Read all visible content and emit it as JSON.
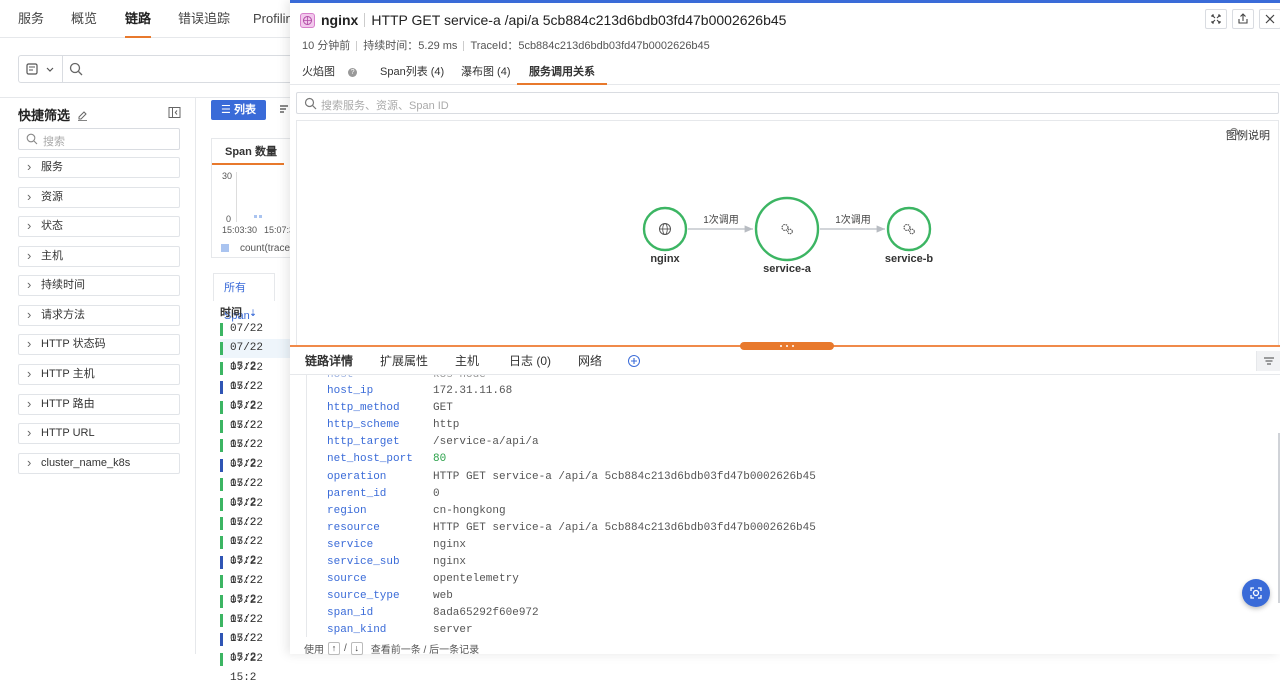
{
  "topnav": {
    "items": [
      "服务",
      "概览",
      "链路",
      "错误追踪",
      "Profilin"
    ],
    "active": 2
  },
  "sidebar": {
    "title": "快捷筛选",
    "search_placeholder": "搜索",
    "facets": [
      "服务",
      "资源",
      "状态",
      "主机",
      "持续时间",
      "请求方法",
      "HTTP 状态码",
      "HTTP 主机",
      "HTTP 路由",
      "HTTP URL",
      "cluster_name_k8s"
    ]
  },
  "list": {
    "list_button": "列表",
    "span_count_tab": "Span 数量",
    "y_max": "30",
    "y_min": "0",
    "x_ticks": [
      "15:03:30",
      "15:07:3"
    ],
    "legend": "count(trace",
    "all_span_tab": "所有 Span",
    "time_header": "时间",
    "rows": [
      {
        "time": "07/22  15:2",
        "color": "#3cb563"
      },
      {
        "time": "07/22  15:2",
        "color": "#3cb563"
      },
      {
        "time": "07/22  15:2",
        "color": "#3cb563"
      },
      {
        "time": "07/22  15:2",
        "color": "#2f55b4"
      },
      {
        "time": "07/22  15:2",
        "color": "#3cb563"
      },
      {
        "time": "07/22  15:2",
        "color": "#3cb563"
      },
      {
        "time": "07/22  15:2",
        "color": "#3cb563"
      },
      {
        "time": "07/22  15:2",
        "color": "#2f55b4"
      },
      {
        "time": "07/22  15:2",
        "color": "#3cb563"
      },
      {
        "time": "07/22  15:2",
        "color": "#3cb563"
      },
      {
        "time": "07/22  15:2",
        "color": "#3cb563"
      },
      {
        "time": "07/22  15:2",
        "color": "#3cb563"
      },
      {
        "time": "07/22  15:2",
        "color": "#2f55b4"
      },
      {
        "time": "07/22  15:2",
        "color": "#3cb563"
      },
      {
        "time": "07/22  15:2",
        "color": "#3cb563"
      },
      {
        "time": "07/22  15:2",
        "color": "#3cb563"
      },
      {
        "time": "07/22  15:2",
        "color": "#2f55b4"
      },
      {
        "time": "07/22  15:2",
        "color": "#3cb563"
      }
    ]
  },
  "panel": {
    "service": "nginx",
    "title": "HTTP GET service-a /api/a 5cb884c213d6bdb03fd47b0002626b45",
    "time_ago": "10 分钟前",
    "duration": "持续时间：5.29 ms",
    "trace_id": "TraceId：5cb884c213d6bdb03fd47b0002626b45",
    "tabs": [
      "火焰图",
      "Span列表 (4)",
      "瀑布图 (4)",
      "服务调用关系"
    ],
    "active_tab": 3,
    "search_placeholder": "搜索服务、资源、Span ID",
    "legend_label": "图例说明",
    "graph": {
      "nodes": [
        {
          "name": "nginx",
          "icon": "globe"
        },
        {
          "name": "service-a",
          "icon": "gears"
        },
        {
          "name": "service-b",
          "icon": "gears"
        }
      ],
      "edges": [
        {
          "from": "nginx",
          "to": "service-a",
          "label": "1次调用"
        },
        {
          "from": "service-a",
          "to": "service-b",
          "label": "1次调用"
        }
      ],
      "node_color": "#3cb563"
    },
    "detail_tabs": [
      "链路详情",
      "扩展属性",
      "主机",
      "日志 (0)",
      "网络"
    ],
    "attributes": [
      {
        "key": "host_ip",
        "value": "172.31.11.68"
      },
      {
        "key": "http_method",
        "value": "GET"
      },
      {
        "key": "http_scheme",
        "value": "http"
      },
      {
        "key": "http_target",
        "value": "/service-a/api/a"
      },
      {
        "key": "net_host_port",
        "value": "80",
        "numeric": true
      },
      {
        "key": "operation",
        "value": "HTTP GET service-a /api/a 5cb884c213d6bdb03fd47b0002626b45"
      },
      {
        "key": "parent_id",
        "value": "0"
      },
      {
        "key": "region",
        "value": "cn-hongkong"
      },
      {
        "key": "resource",
        "value": "HTTP GET service-a /api/a 5cb884c213d6bdb03fd47b0002626b45"
      },
      {
        "key": "service",
        "value": "nginx"
      },
      {
        "key": "service_sub",
        "value": "nginx"
      },
      {
        "key": "source",
        "value": "opentelemetry"
      },
      {
        "key": "source_type",
        "value": "web"
      },
      {
        "key": "span_id",
        "value": "8ada65292f60e972"
      },
      {
        "key": "span_kind",
        "value": "server"
      }
    ],
    "footer": {
      "prefix": "使用",
      "up_key": "↑",
      "slash": "/",
      "down_key": "↓",
      "suffix": "查看前一条 / 后一条记录"
    }
  },
  "colors": {
    "accent": "#3a6bd8",
    "tab_active": "#e8792c",
    "node": "#3cb563"
  }
}
